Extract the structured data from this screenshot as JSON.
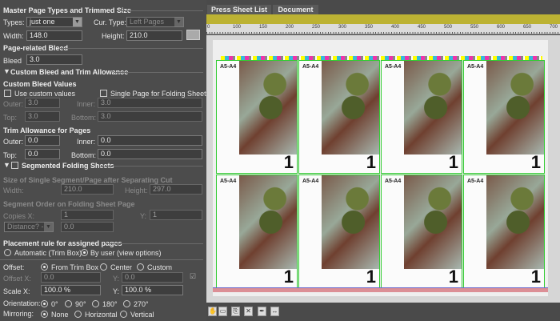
{
  "left": {
    "master": {
      "title": "Master Page Types and Trimmed Size",
      "types_label": "Types:",
      "types_value": "just one",
      "cur_type_label": "Cur. Type:",
      "cur_type_value": "Left Pages",
      "width_label": "Width:",
      "width_value": "148.0",
      "height_label": "Height:",
      "height_value": "210.0"
    },
    "bleed": {
      "title": "Page-related Bleed",
      "label": "Bleed",
      "value": "3.0"
    },
    "custom": {
      "title": "Custom Bleed and Trim Allowance",
      "values_title": "Custom Bleed Values",
      "use_custom": "Use custom values",
      "single_page": "Single Page for Folding Sheet",
      "outer_label": "Outer:",
      "outer": "3.0",
      "inner_label": "Inner:",
      "inner": "3.0",
      "top_label": "Top:",
      "top": "3.0",
      "bottom_label": "Bottom:",
      "bottom": "3.0"
    },
    "trim": {
      "title": "Trim Allowance for Pages",
      "outer_label": "Outer:",
      "outer": "0.0",
      "inner_label": "Inner:",
      "inner": "0.0",
      "top_label": "Top:",
      "top": "0.0",
      "bottom_label": "Bottom:",
      "bottom": "0.0"
    },
    "segmented": {
      "title": "Segmented Folding Sheets",
      "size_title": "Size of Single Segment/Page after Separating Cut",
      "width_label": "Width:",
      "width": "210.0",
      "height_label": "Height:",
      "height": "297.0",
      "order_title": "Segment Order on Folding Sheet Page",
      "copies_x_label": "Copies X:",
      "copies_x": "1",
      "y_label": "Y:",
      "copies_y": "1",
      "distance_value": "Distance? - ?",
      "distance": "0.0"
    },
    "placement": {
      "title": "Placement rule for assigned pages",
      "automatic": "Automatic (Trim Box)",
      "by_user": "By user (view options)"
    },
    "offset": {
      "label": "Offset:",
      "from_trim": "From Trim Box",
      "center": "Center",
      "custom": "Custom",
      "offset_x_label": "Offset X:",
      "offset_x": "0.0",
      "y_label": "Y:",
      "offset_y": "0.0",
      "scale_x_label": "Scale X:",
      "scale_x": "100.0 %",
      "scale_y": "100.0 %",
      "orientation_label": "Orientation:",
      "o0": "0°",
      "o90": "90°",
      "o180": "180°",
      "o270": "270°",
      "mirroring_label": "Mirroring:",
      "none": "None",
      "horizontal": "Horizontal",
      "vertical": "Vertical"
    }
  },
  "tabs": [
    "Press Sheet List",
    "Document"
  ],
  "ruler": [
    "0",
    "100",
    "150",
    "200",
    "250",
    "300",
    "350",
    "400",
    "450",
    "500",
    "550",
    "600",
    "650",
    "700"
  ],
  "pages": [
    {
      "label": "A5-A4",
      "number": "1"
    },
    {
      "label": "A5-A4",
      "number": "1"
    },
    {
      "label": "A5-A4",
      "number": "1"
    },
    {
      "label": "A5-A4",
      "number": "1"
    },
    {
      "label": "A5-A4",
      "number": "1"
    },
    {
      "label": "A5-A4",
      "number": "1"
    },
    {
      "label": "A5-A4",
      "number": "1"
    },
    {
      "label": "A5-A4",
      "number": "1"
    }
  ],
  "colors": {
    "accent_bar": "#bcb233",
    "page_border": "#33cc33",
    "slug": "#dc8f96"
  }
}
